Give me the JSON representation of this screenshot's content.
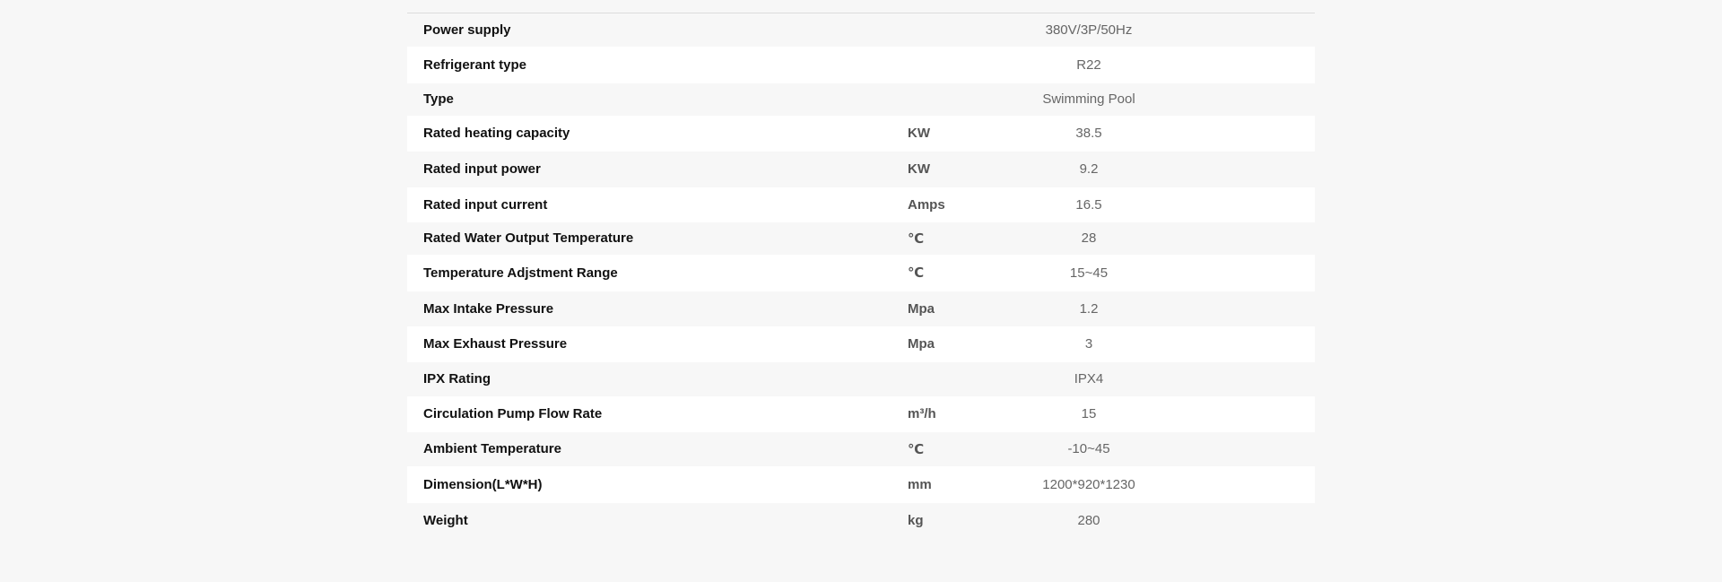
{
  "spec_table": {
    "rows": [
      {
        "name": "Power supply",
        "unit": "",
        "value": "380V/3P/50Hz"
      },
      {
        "name": "Refrigerant type",
        "unit": "",
        "value": "R22"
      },
      {
        "name": "Type",
        "unit": "",
        "value": "Swimming Pool"
      },
      {
        "name": "Rated heating capacity",
        "unit": "KW",
        "value": "38.5"
      },
      {
        "name": "Rated input power",
        "unit": "KW",
        "value": "9.2"
      },
      {
        "name": "Rated input current",
        "unit": "Amps",
        "value": "16.5"
      },
      {
        "name": "Rated Water Output Temperature",
        "unit": "℃",
        "value": "28"
      },
      {
        "name": "Temperature Adjstment Range",
        "unit": "℃",
        "value": "15~45"
      },
      {
        "name": "Max Intake Pressure",
        "unit": "Mpa",
        "value": "1.2"
      },
      {
        "name": "Max Exhaust Pressure",
        "unit": "Mpa",
        "value": "3"
      },
      {
        "name": "IPX Rating",
        "unit": "",
        "value": "IPX4"
      },
      {
        "name": "Circulation Pump Flow Rate",
        "unit": "m³/h",
        "value": "15"
      },
      {
        "name": "Ambient Temperature",
        "unit": "℃",
        "value": "-10~45"
      },
      {
        "name": "Dimension(L*W*H)",
        "unit": "mm",
        "value": "1200*920*1230"
      },
      {
        "name": "Weight",
        "unit": "kg",
        "value": "280"
      }
    ]
  }
}
